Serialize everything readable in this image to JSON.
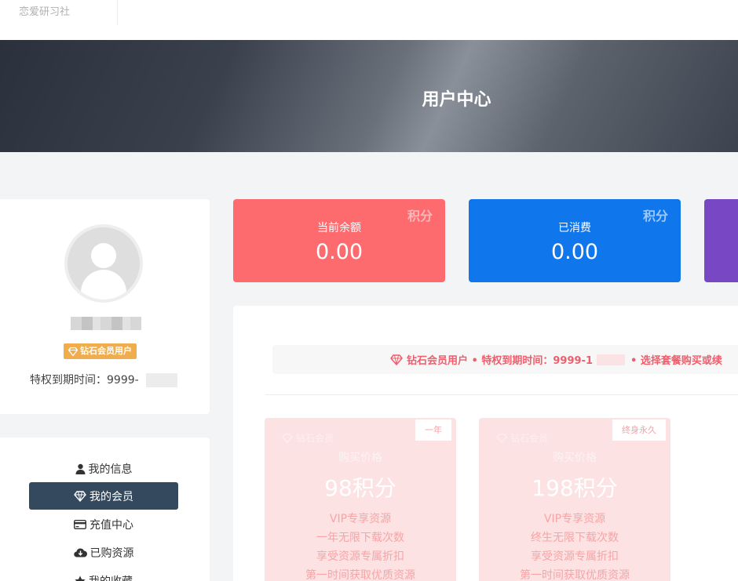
{
  "header": {
    "logo_text": "恋爱研习社"
  },
  "banner": {
    "title": "用户中心"
  },
  "profile": {
    "badge": "钻石会员用户",
    "expire_label": "特权到期时间：",
    "expire_value": "9999-"
  },
  "menu": {
    "items": [
      {
        "label": "我的信息",
        "icon": "user-icon"
      },
      {
        "label": "我的会员",
        "icon": "diamond-icon",
        "active": true
      },
      {
        "label": "充值中心",
        "icon": "credit-card-icon"
      },
      {
        "label": "已购资源",
        "icon": "cloud-download-icon"
      },
      {
        "label": "我的收藏",
        "icon": "star-icon"
      }
    ]
  },
  "stats": [
    {
      "label": "当前余额",
      "value": "0.00",
      "unit": "积分",
      "color": "#fe6b6f"
    },
    {
      "label": "已消费",
      "value": "0.00",
      "unit": "积分",
      "color": "#0f76ec"
    }
  ],
  "notice": {
    "part1": "钻石会员用户 • 特权到期时间：9999-1",
    "part2": "• 选择套餐购买或续"
  },
  "plans": [
    {
      "name": "钻石会员",
      "tag": "一年",
      "price_label": "购买价格",
      "price": "98积分",
      "features": [
        "VIP专享资源",
        "一年无限下载次数",
        "享受资源专属折扣",
        "第一时间获取优质资源"
      ]
    },
    {
      "name": "钻石会员",
      "tag": "终身永久",
      "price_label": "购买价格",
      "price": "198积分",
      "features": [
        "VIP专享资源",
        "终生无限下载次数",
        "享受资源专属折扣",
        "第一时间获取优质资源"
      ]
    }
  ],
  "colors": {
    "accent_dark": "#34495e",
    "notice_red": "#ef5e6c",
    "badge_orange": "#f0ad4e"
  }
}
